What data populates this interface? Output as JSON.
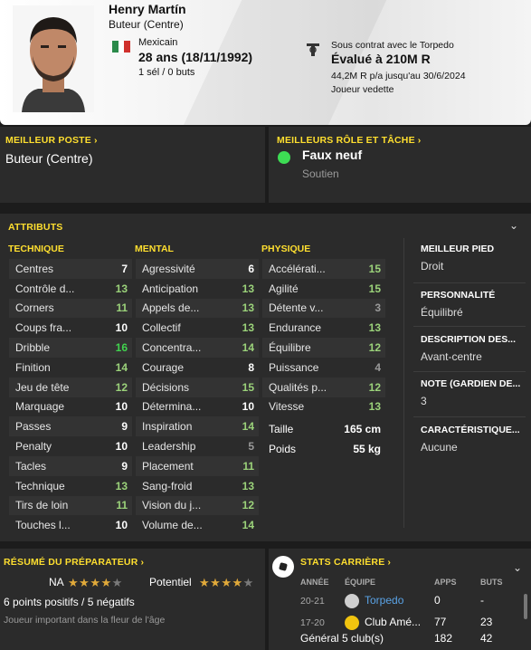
{
  "player": {
    "name": "Henry Martín",
    "position": "Buteur (Centre)",
    "nationality": "Mexicain",
    "age": "28 ans (18/11/1992)",
    "caps": "1 sél / 0 buts",
    "contract": "Sous contrat avec le Torpedo",
    "value": "Évalué à 210M R",
    "wage": "44,2M R p/a jusqu'au 30/6/2024",
    "squad_role": "Joueur vedette"
  },
  "best_position": {
    "title": "MEILLEUR POSTE",
    "value": "Buteur (Centre)"
  },
  "best_role": {
    "title": "MEILLEURS RÔLE ET TÂCHE",
    "value": "Faux neuf",
    "duty": "Soutien",
    "color": "#3ddc54"
  },
  "attributes": {
    "title": "ATTRIBUTS",
    "technical": {
      "title": "TECHNIQUE",
      "rows": [
        {
          "label": "Centres",
          "value": "7"
        },
        {
          "label": "Contrôle d...",
          "value": "13"
        },
        {
          "label": "Corners",
          "value": "11"
        },
        {
          "label": "Coups fra...",
          "value": "10"
        },
        {
          "label": "Dribble",
          "value": "16"
        },
        {
          "label": "Finition",
          "value": "14"
        },
        {
          "label": "Jeu de tête",
          "value": "12"
        },
        {
          "label": "Marquage",
          "value": "10"
        },
        {
          "label": "Passes",
          "value": "9"
        },
        {
          "label": "Penalty",
          "value": "10"
        },
        {
          "label": "Tacles",
          "value": "9"
        },
        {
          "label": "Technique",
          "value": "13"
        },
        {
          "label": "Tirs de loin",
          "value": "11"
        },
        {
          "label": "Touches l...",
          "value": "10"
        }
      ]
    },
    "mental": {
      "title": "MENTAL",
      "rows": [
        {
          "label": "Agressivité",
          "value": "6"
        },
        {
          "label": "Anticipation",
          "value": "13"
        },
        {
          "label": "Appels de...",
          "value": "13"
        },
        {
          "label": "Collectif",
          "value": "13"
        },
        {
          "label": "Concentra...",
          "value": "14"
        },
        {
          "label": "Courage",
          "value": "8"
        },
        {
          "label": "Décisions",
          "value": "15"
        },
        {
          "label": "Détermina...",
          "value": "10"
        },
        {
          "label": "Inspiration",
          "value": "14"
        },
        {
          "label": "Leadership",
          "value": "5"
        },
        {
          "label": "Placement",
          "value": "11"
        },
        {
          "label": "Sang-froid",
          "value": "13"
        },
        {
          "label": "Vision du j...",
          "value": "12"
        },
        {
          "label": "Volume de...",
          "value": "14"
        }
      ]
    },
    "physical": {
      "title": "PHYSIQUE",
      "rows": [
        {
          "label": "Accélérati...",
          "value": "15"
        },
        {
          "label": "Agilité",
          "value": "15"
        },
        {
          "label": "Détente v...",
          "value": "3"
        },
        {
          "label": "Endurance",
          "value": "13"
        },
        {
          "label": "Équilibre",
          "value": "12"
        },
        {
          "label": "Puissance",
          "value": "4"
        },
        {
          "label": "Qualités p...",
          "value": "12"
        },
        {
          "label": "Vitesse",
          "value": "13"
        }
      ],
      "height_label": "Taille",
      "height": "165 cm",
      "weight_label": "Poids",
      "weight": "55 kg"
    }
  },
  "side_info": [
    {
      "title": "MEILLEUR PIED",
      "value": "Droit"
    },
    {
      "title": "PERSONNALITÉ",
      "value": "Équilibré"
    },
    {
      "title": "DESCRIPTION DES...",
      "value": "Avant-centre"
    },
    {
      "title": "NOTE (GARDIEN DE...",
      "value": "3"
    },
    {
      "title": "CARACTÉRISTIQUE...",
      "value": "Aucune"
    }
  ],
  "coach": {
    "title": "RÉSUMÉ DU PRÉPARATEUR",
    "na_label": "NA",
    "na_stars": 4,
    "na_max": 5,
    "pot_label": "Potentiel",
    "pot_stars": 4,
    "pot_max": 5,
    "points": "6 points positifs / 5 négatifs",
    "note": "Joueur important dans la fleur de l'âge"
  },
  "career": {
    "title": "STATS CARRIÈRE",
    "headers": {
      "year": "ANNÉE",
      "club": "ÉQUIPE",
      "apps": "APPS",
      "goals": "BUTS"
    },
    "rows": [
      {
        "year": "20-21",
        "club": "Torpedo",
        "apps": "0",
        "goals": "-",
        "club_color": "#5aa3e6"
      },
      {
        "year": "17-20",
        "club": "Club Amé...",
        "apps": "77",
        "goals": "23",
        "club_color": "#ffffff"
      }
    ],
    "total": {
      "label": "Général 5 club(s)",
      "apps": "182",
      "goals": "42"
    }
  },
  "colors": {
    "accent": "#ffdf2f",
    "green_high": "#41d34e",
    "green": "#9bd27a",
    "grey_low": "#999999"
  }
}
